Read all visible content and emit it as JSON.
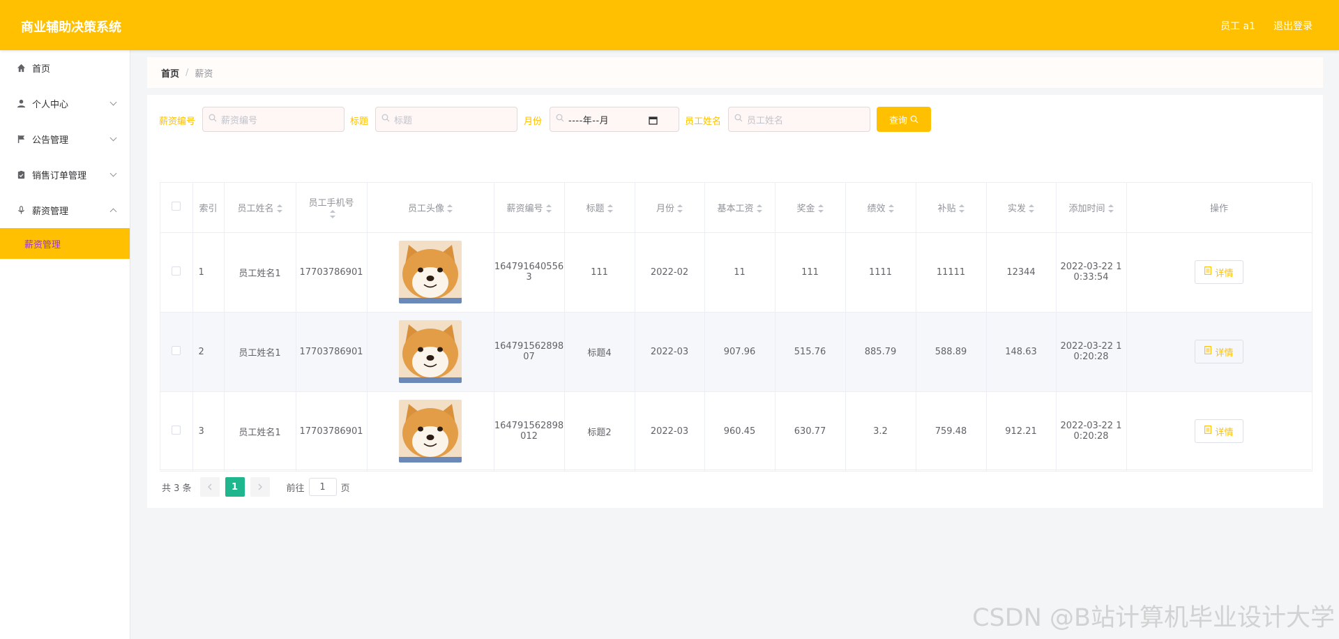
{
  "header": {
    "app_title": "商业辅助决策系统",
    "user_label": "员工 a1",
    "logout_label": "退出登录"
  },
  "sidebar": {
    "items": [
      {
        "label": "首页",
        "icon": "home-icon"
      },
      {
        "label": "个人中心",
        "icon": "user-icon"
      },
      {
        "label": "公告管理",
        "icon": "flag-icon"
      },
      {
        "label": "销售订单管理",
        "icon": "clipboard-icon"
      },
      {
        "label": "薪资管理",
        "icon": "microphone-icon"
      }
    ],
    "active_sub": "薪资管理"
  },
  "breadcrumb": {
    "home": "首页",
    "separator": "/",
    "current": "薪资"
  },
  "search": {
    "fields": [
      {
        "label": "薪资编号",
        "placeholder": "薪资编号"
      },
      {
        "label": "标题",
        "placeholder": "标题"
      },
      {
        "label": "月份",
        "placeholder": "----年--月"
      },
      {
        "label": "员工姓名",
        "placeholder": "员工姓名"
      }
    ],
    "query_label": "查询"
  },
  "table": {
    "columns": [
      "索引",
      "员工姓名",
      "员工手机号",
      "员工头像",
      "薪资编号",
      "标题",
      "月份",
      "基本工资",
      "奖金",
      "绩效",
      "补贴",
      "实发",
      "添加时间",
      "操作"
    ],
    "rows": [
      {
        "index": "1",
        "name": "员工姓名1",
        "phone": "17703786901",
        "salary_no": "1647916405563",
        "title": "111",
        "month": "2022-02",
        "base": "11",
        "bonus": "111",
        "perf": "1111",
        "subsidy": "11111",
        "actual": "12344",
        "added": "2022-03-22 10:33:54"
      },
      {
        "index": "2",
        "name": "员工姓名1",
        "phone": "17703786901",
        "salary_no": "16479156289807",
        "title": "标题4",
        "month": "2022-03",
        "base": "907.96",
        "bonus": "515.76",
        "perf": "885.79",
        "subsidy": "588.89",
        "actual": "148.63",
        "added": "2022-03-22 10:20:28"
      },
      {
        "index": "3",
        "name": "员工姓名1",
        "phone": "17703786901",
        "salary_no": "164791562898012",
        "title": "标题2",
        "month": "2022-03",
        "base": "960.45",
        "bonus": "630.77",
        "perf": "3.2",
        "subsidy": "759.48",
        "actual": "912.21",
        "added": "2022-03-22 10:20:28"
      }
    ],
    "detail_label": "详情"
  },
  "pagination": {
    "total": "共 3 条",
    "current_page": "1",
    "goto_label": "前往",
    "goto_value": "1",
    "page_suffix": "页"
  },
  "watermark": "CSDN @B站计算机毕业设计大学",
  "colors": {
    "brand": "#fec001",
    "active_text": "#9b35c9",
    "page_active": "#20b68d"
  }
}
